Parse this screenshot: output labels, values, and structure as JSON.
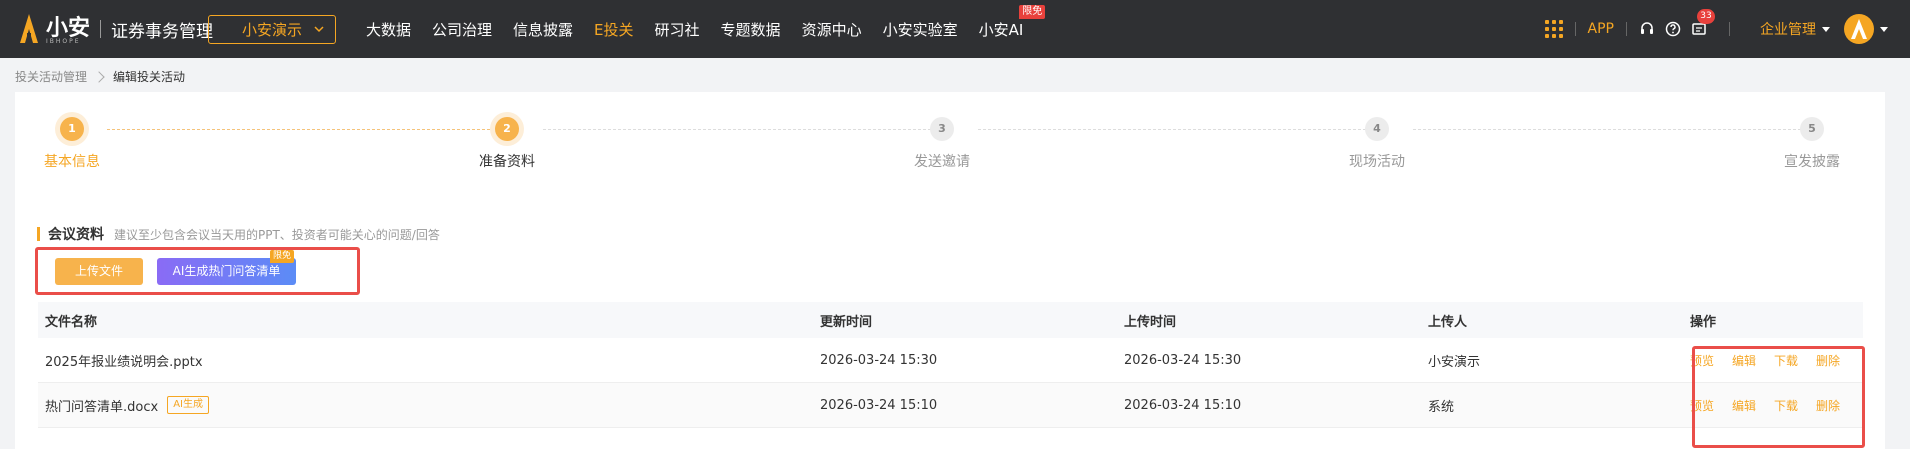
{
  "header": {
    "logo_text": "小安",
    "logo_sub": "IBHOPE",
    "product_name": "证券事务管理",
    "org_select": "小安演示",
    "nav": [
      {
        "label": "大数据",
        "active": false
      },
      {
        "label": "公司治理",
        "active": false
      },
      {
        "label": "信息披露",
        "active": false
      },
      {
        "label": "E投关",
        "active": true
      },
      {
        "label": "研习社",
        "active": false
      },
      {
        "label": "专题数据",
        "active": false
      },
      {
        "label": "资源中心",
        "active": false
      },
      {
        "label": "小安实验室",
        "active": false
      },
      {
        "label": "小安AI",
        "active": false,
        "badge": "限免"
      }
    ],
    "app_label": "APP",
    "message_count": "33",
    "enterprise_menu": "企业管理",
    "icons": [
      "apps-grid-icon",
      "headset-icon",
      "help-icon",
      "message-icon",
      "chevron-down-icon"
    ]
  },
  "breadcrumb": {
    "parent": "投关活动管理",
    "current": "编辑投关活动"
  },
  "steps": [
    {
      "num": "1",
      "label": "基本信息",
      "state": "done"
    },
    {
      "num": "2",
      "label": "准备资料",
      "state": "current"
    },
    {
      "num": "3",
      "label": "发送邀请",
      "state": "todo"
    },
    {
      "num": "4",
      "label": "现场活动",
      "state": "todo"
    },
    {
      "num": "5",
      "label": "宣发披露",
      "state": "todo"
    }
  ],
  "section": {
    "title": "会议资料",
    "hint": "建议至少包含会议当天用的PPT、投资者可能关心的问题/回答"
  },
  "buttons": {
    "upload": "上传文件",
    "ai_generate": "AI生成热门问答清单",
    "ai_badge": "限免"
  },
  "table": {
    "columns": [
      "文件名称",
      "更新时间",
      "上传时间",
      "上传人",
      "操作"
    ],
    "rows": [
      {
        "name": "2025年报业绩说明会.pptx",
        "tag": "",
        "updated": "2026-03-24 15:30",
        "uploaded": "2026-03-24 15:30",
        "uploader": "小安演示"
      },
      {
        "name": "热门问答清单.docx",
        "tag": "AI生成",
        "updated": "2026-03-24 15:10",
        "uploaded": "2026-03-24 15:10",
        "uploader": "系统"
      }
    ],
    "actions": [
      "预览",
      "编辑",
      "下载",
      "删除"
    ]
  },
  "colors": {
    "accent": "#f5a623",
    "nav_bg": "#2f3033",
    "highlight_box": "#ea4e49",
    "ai_gradient_start": "#8a6bf5",
    "ai_gradient_end": "#5b8cf6"
  }
}
